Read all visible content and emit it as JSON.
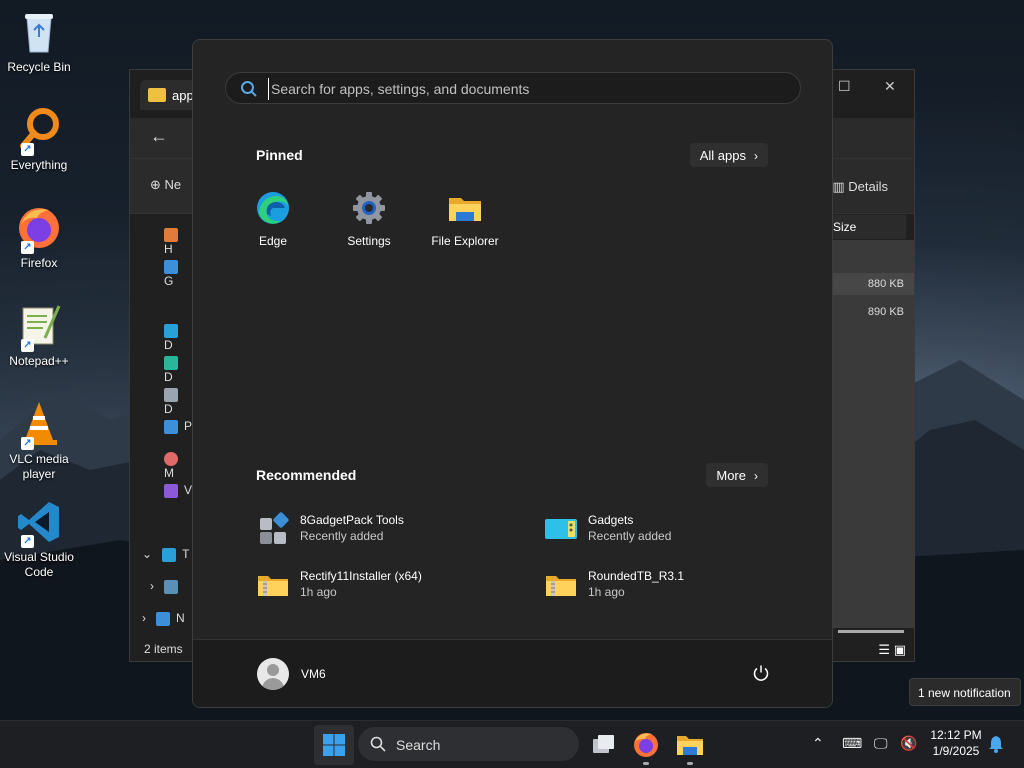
{
  "desktop": {
    "icons": [
      {
        "label": "Recycle Bin"
      },
      {
        "label": "Everything"
      },
      {
        "label": "Firefox"
      },
      {
        "label": "Notepad++"
      },
      {
        "label": "VLC media player"
      },
      {
        "label": "Visual Studio Code"
      }
    ]
  },
  "explorer": {
    "tab_title": "app",
    "new_label": "Ne",
    "details_label": "Details",
    "column_size": "Size",
    "sizes": [
      "880 KB",
      "890 KB"
    ],
    "status": "2 items",
    "sidebar_letters": [
      "H",
      "G",
      "D",
      "D",
      "D",
      "P",
      "M",
      "V",
      "T",
      "N"
    ]
  },
  "start_menu": {
    "search_placeholder": "Search for apps, settings, and documents",
    "pinned_title": "Pinned",
    "all_apps_label": "All apps",
    "pinned": [
      {
        "label": "Edge",
        "icon": "edge-icon"
      },
      {
        "label": "Settings",
        "icon": "settings-gear-icon"
      },
      {
        "label": "File Explorer",
        "icon": "file-explorer-icon"
      }
    ],
    "recommended_title": "Recommended",
    "more_label": "More",
    "recommended": [
      {
        "name": "8GadgetPack Tools",
        "sub": "Recently added"
      },
      {
        "name": "Gadgets",
        "sub": "Recently added"
      },
      {
        "name": "Rectify11Installer (x64)",
        "sub": "1h ago"
      },
      {
        "name": "RoundedTB_R3.1",
        "sub": "1h ago"
      }
    ],
    "user_name": "VM6"
  },
  "notification": {
    "text": "1 new notification"
  },
  "taskbar": {
    "search_label": "Search",
    "time": "12:12 PM",
    "date": "1/9/2025"
  }
}
